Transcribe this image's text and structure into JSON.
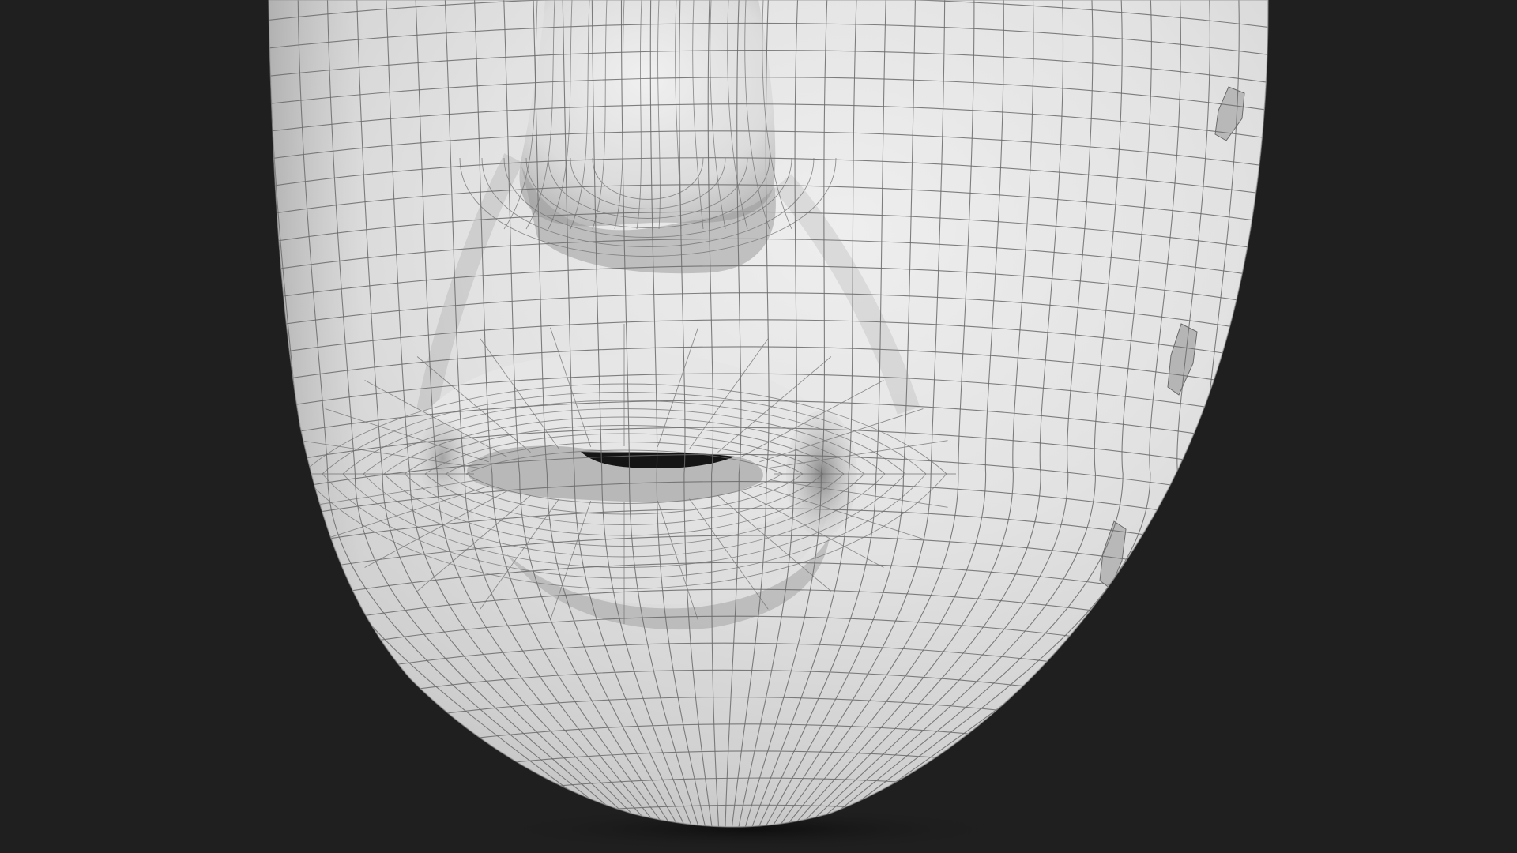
{
  "scene": {
    "subject": "subdivided-head-mesh",
    "background_color": "#1f1f1f",
    "mesh_base_color": "#e4e4e4",
    "mesh_shadow_color": "#9a9a9a",
    "wire_color": "#6a6a6a",
    "mouth_cavity_color": "#151515"
  }
}
